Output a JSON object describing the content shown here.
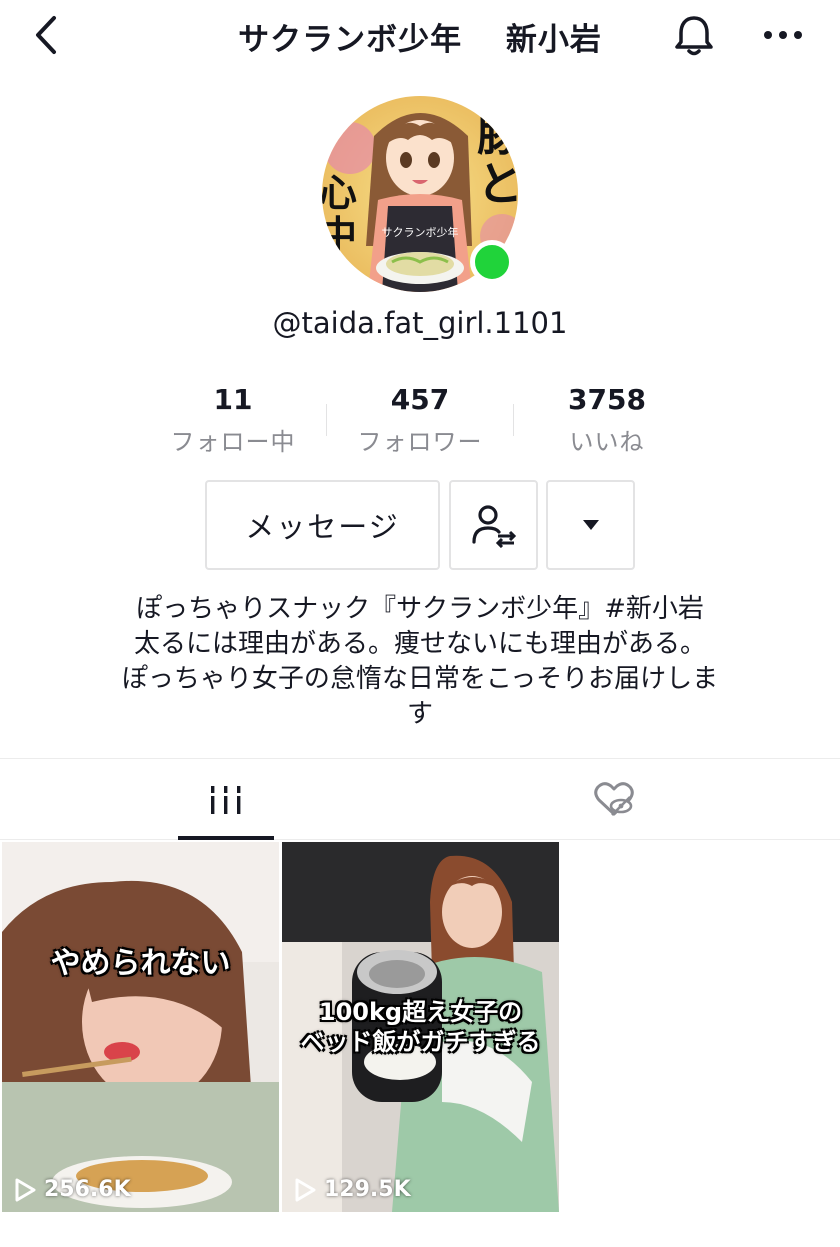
{
  "header": {
    "title_left": "サクランボ少年",
    "title_right": "新小岩"
  },
  "profile": {
    "username": "@taida.fat_girl.1101",
    "online": true
  },
  "stats": [
    {
      "value": "11",
      "label": "フォロー中"
    },
    {
      "value": "457",
      "label": "フォロワー"
    },
    {
      "value": "3758",
      "label": "いいね"
    }
  ],
  "actions": {
    "message_label": "メッセージ"
  },
  "bio": {
    "line1": "ぽっちゃりスナック『サクランボ少年』#新小岩",
    "line2": "太るには理由がある。痩せないにも理由がある。",
    "line3": "ぽっちゃり女子の怠惰な日常をこっそりお届けしま",
    "line4": "す"
  },
  "avatar": {
    "text_top": "豚と",
    "text_left": "心中",
    "apron": "サクランボ少年"
  },
  "videos": [
    {
      "caption": "やめられない",
      "views": "256.6K"
    },
    {
      "caption_line1": "100kg超え女子の",
      "caption_line2": "ベッド飯がガチすぎる",
      "views": "129.5K"
    }
  ],
  "colors": {
    "online": "#20d33a",
    "secondary_text": "#8a8b91",
    "primary_text": "#161823"
  }
}
